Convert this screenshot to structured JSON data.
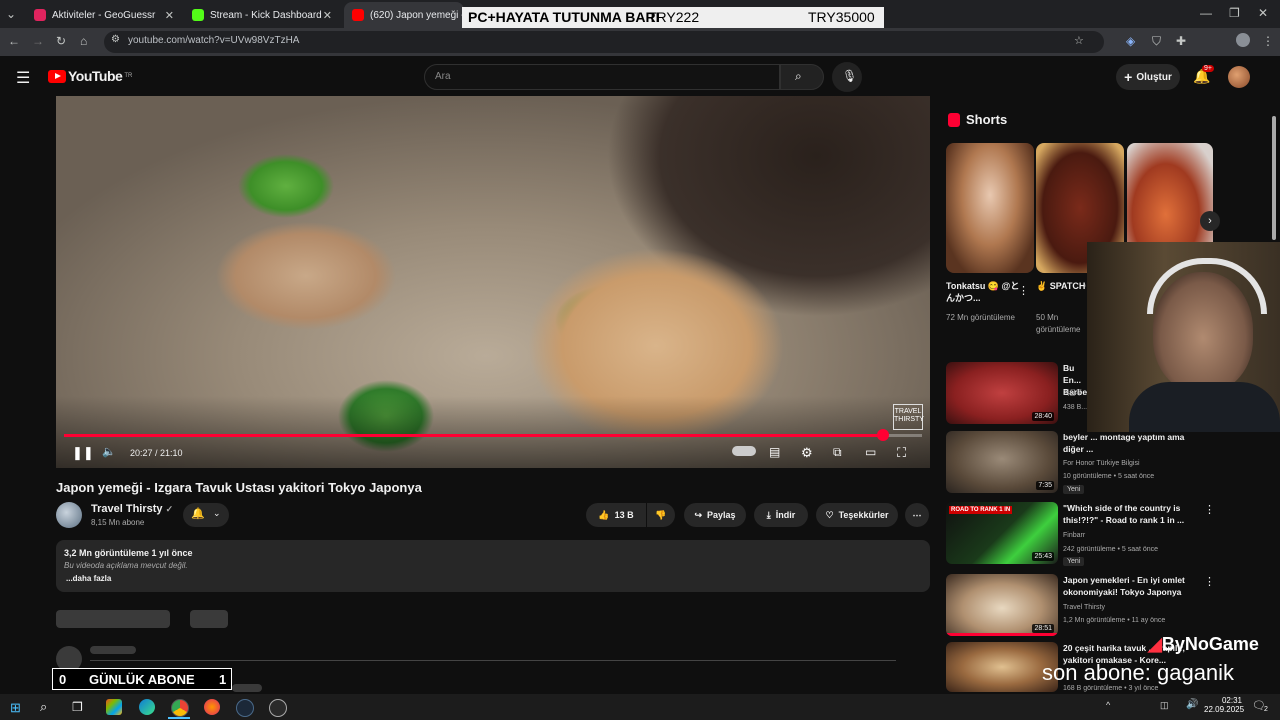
{
  "browser": {
    "tabs": [
      {
        "title": "Aktiviteler - GeoGuessr",
        "fav_color": "#e0245e"
      },
      {
        "title": "Stream - Kick Dashboard",
        "fav_color": "#53fc18"
      },
      {
        "title": "(620) Japon yemeği - Izgar",
        "fav_color": "#ff0000"
      }
    ],
    "url": "youtube.com/watch?v=UVw98VzTzHA"
  },
  "stream_overlay": {
    "label": "PC+HAYATA TUTUNMA BARI",
    "current": "TRY222",
    "goal": "TRY35000"
  },
  "youtube": {
    "logo_text": "YouTube",
    "region": "TR",
    "search_placeholder": "Ara",
    "create_label": "Oluştur",
    "notif_badge": "9+"
  },
  "player": {
    "time": "20:27 / 21:10",
    "progress": 0.955,
    "watermark": "TRAVEL THIRSTY"
  },
  "video": {
    "title": "Japon yemeği - Izgara Tavuk Ustası yakitori Tokyo Japonya",
    "channel": "Travel Thirsty",
    "subscribers": "8,15 Mn abone",
    "likes": "13 B",
    "share": "Paylaş",
    "download": "İndir",
    "thanks": "Teşekkürler",
    "views_date": "3,2 Mn görüntüleme  1 yıl önce",
    "description": "Bu videoda açıklama mevcut değil.",
    "more": "...daha fazla"
  },
  "daily_subs": {
    "left": "0",
    "label": "GÜNLÜK ABONE",
    "right": "1"
  },
  "shorts": {
    "heading": "Shorts",
    "items": [
      {
        "title": "Tonkatsu 😋 @とんかつ...",
        "views": "72 Mn görüntüleme"
      },
      {
        "title": "✌ SPATCHCO",
        "views": "50 Mn görüntüleme"
      },
      {
        "title": "",
        "views": ""
      }
    ]
  },
  "related": [
    {
      "title": "Bu En... Barbe...",
      "channel": "겨울푸...",
      "meta": "438 B...",
      "duration": "28:40"
    },
    {
      "title": "beyler ... montage yaptım ama diğer ...",
      "channel": "For Honor Türkiye Bilgisi",
      "meta": "10 görüntüleme • 5 saat önce",
      "duration": "7:35",
      "badge": "Yeni"
    },
    {
      "title": "\"Which side of the country is this!?!?\" - Road to rank 1 in ...",
      "channel": "Finbarr",
      "meta": "242 görüntüleme • 5 saat önce",
      "duration": "25:43",
      "badge": "Yeni"
    },
    {
      "title": "Japon yemekleri - En iyi omlet okonomiyaki! Tokyo Japonya",
      "channel": "Travel Thirsty",
      "meta": "1,2 Mn görüntüleme • 11 ay önce",
      "duration": "28:51"
    },
    {
      "title": "20 çeşit harika tavuk ... yapılır, yakitori omakase - Kore...",
      "channel": "",
      "meta": "168 B görüntüleme • 3 yıl önce",
      "duration": ""
    }
  ],
  "stream_watermark": {
    "brand": "ByNoGame",
    "last_sub": "son abone: gaganik"
  },
  "taskbar": {
    "time": "02:31",
    "date": "22.09.2025",
    "notif": "2"
  }
}
